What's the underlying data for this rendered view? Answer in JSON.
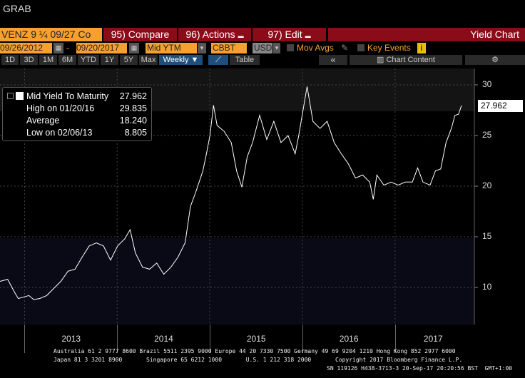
{
  "header": {
    "title": "GRAB"
  },
  "toolbar": {
    "security": "VENZ 9 ¼ 09/27 Co",
    "compare": "95) Compare",
    "actions": "96) Actions",
    "edit": "97) Edit",
    "function_title": "Yield Chart"
  },
  "controls": {
    "start_date": "09/26/2012",
    "dash": "-",
    "end_date": "09/20/2017",
    "field": "Mid YTM",
    "source": "CBBT",
    "currency": "USD",
    "mov_avgs": "Mov Avgs",
    "key_events": "Key Events",
    "info": "i"
  },
  "periods": [
    "1D",
    "3D",
    "1M",
    "6M",
    "YTD",
    "1Y",
    "5Y",
    "Max"
  ],
  "frequency": "Weekly ▼",
  "view": {
    "table": "Table",
    "collapse": "«",
    "chart_content": "Chart Content",
    "settings": "⚙"
  },
  "legend": {
    "rows": [
      {
        "label": "Mid Yield To Maturity",
        "value": "27.962"
      },
      {
        "label": "High on 01/20/16",
        "value": "29.835"
      },
      {
        "label": "Average",
        "value": "18.240"
      },
      {
        "label": "Low on 02/06/13",
        "value": "8.805"
      }
    ]
  },
  "current_value": "27.962",
  "colors": {
    "toolbar_red": "#8a0c18",
    "orange": "#f7a030",
    "line": "#ffffff",
    "active_tab": "#1f4e7a"
  },
  "chart_data": {
    "type": "line",
    "ylim": [
      7,
      31
    ],
    "yticks": [
      "30",
      "25",
      "20",
      "15",
      "10"
    ],
    "xticks": [
      "2013",
      "2014",
      "2015",
      "2016",
      "2017"
    ],
    "grid": true,
    "legend_position": "top-left",
    "series": [
      {
        "name": "Mid Yield To Maturity",
        "points": [
          [
            "2012-09-26",
            10.6
          ],
          [
            "2012-10-26",
            10.8
          ],
          [
            "2012-11-23",
            9.5
          ],
          [
            "2012-12-07",
            8.9
          ],
          [
            "2013-01-18",
            9.2
          ],
          [
            "2013-02-06",
            8.8
          ],
          [
            "2013-03-01",
            8.9
          ],
          [
            "2013-03-29",
            9.2
          ],
          [
            "2013-04-26",
            9.9
          ],
          [
            "2013-05-24",
            10.6
          ],
          [
            "2013-06-21",
            11.6
          ],
          [
            "2013-07-19",
            11.8
          ],
          [
            "2013-08-16",
            13.0
          ],
          [
            "2013-09-13",
            14.1
          ],
          [
            "2013-10-11",
            14.4
          ],
          [
            "2013-11-08",
            14.1
          ],
          [
            "2013-12-06",
            12.7
          ],
          [
            "2014-01-03",
            14.1
          ],
          [
            "2014-01-31",
            14.8
          ],
          [
            "2014-02-21",
            15.7
          ],
          [
            "2014-03-14",
            13.4
          ],
          [
            "2014-04-11",
            12.0
          ],
          [
            "2014-05-09",
            11.8
          ],
          [
            "2014-06-06",
            12.4
          ],
          [
            "2014-07-04",
            11.3
          ],
          [
            "2014-08-01",
            12.0
          ],
          [
            "2014-08-29",
            13.0
          ],
          [
            "2014-09-26",
            14.4
          ],
          [
            "2014-10-17",
            18.0
          ],
          [
            "2014-11-07",
            19.4
          ],
          [
            "2014-12-05",
            21.5
          ],
          [
            "2014-12-19",
            23.2
          ],
          [
            "2015-01-02",
            25.0
          ],
          [
            "2015-01-16",
            28.0
          ],
          [
            "2015-01-30",
            26.0
          ],
          [
            "2015-02-27",
            25.4
          ],
          [
            "2015-03-27",
            24.3
          ],
          [
            "2015-04-17",
            21.5
          ],
          [
            "2015-05-08",
            19.9
          ],
          [
            "2015-05-29",
            22.9
          ],
          [
            "2015-06-19",
            24.3
          ],
          [
            "2015-07-17",
            27.0
          ],
          [
            "2015-08-14",
            24.6
          ],
          [
            "2015-09-11",
            26.4
          ],
          [
            "2015-10-09",
            24.3
          ],
          [
            "2015-11-06",
            25.0
          ],
          [
            "2015-12-04",
            23.2
          ],
          [
            "2015-12-18",
            25.0
          ],
          [
            "2016-01-20",
            29.835
          ],
          [
            "2016-02-12",
            26.4
          ],
          [
            "2016-03-11",
            25.7
          ],
          [
            "2016-04-08",
            26.4
          ],
          [
            "2016-05-06",
            24.3
          ],
          [
            "2016-06-03",
            23.2
          ],
          [
            "2016-07-01",
            22.2
          ],
          [
            "2016-07-29",
            20.8
          ],
          [
            "2016-08-26",
            21.1
          ],
          [
            "2016-09-23",
            20.4
          ],
          [
            "2016-10-07",
            18.7
          ],
          [
            "2016-10-21",
            21.1
          ],
          [
            "2016-11-18",
            20.1
          ],
          [
            "2016-12-16",
            20.4
          ],
          [
            "2017-01-13",
            20.1
          ],
          [
            "2017-02-10",
            20.4
          ],
          [
            "2017-03-10",
            20.4
          ],
          [
            "2017-03-31",
            21.8
          ],
          [
            "2017-04-21",
            20.4
          ],
          [
            "2017-05-19",
            20.1
          ],
          [
            "2017-06-09",
            21.5
          ],
          [
            "2017-06-30",
            21.7
          ],
          [
            "2017-07-21",
            24.3
          ],
          [
            "2017-08-11",
            25.7
          ],
          [
            "2017-08-25",
            27.0
          ],
          [
            "2017-09-08",
            27.1
          ],
          [
            "2017-09-20",
            27.962
          ]
        ]
      }
    ]
  },
  "footer": {
    "line1": "Australia 61 2 9777 8600 Brazil 5511 2395 9000 Europe 44 20 7330 7500 Germany 49 69 9204 1210 Hong Kong 852 2977 6000",
    "line2": "Japan 81 3 3201 8900       Singapore 65 6212 1000       U.S. 1 212 318 2000       Copyright 2017 Bloomberg Finance L.P.",
    "line3": "SN 119126 H438-3713-3 20-Sep-17 20:20:56 BST  GMT+1:00"
  }
}
